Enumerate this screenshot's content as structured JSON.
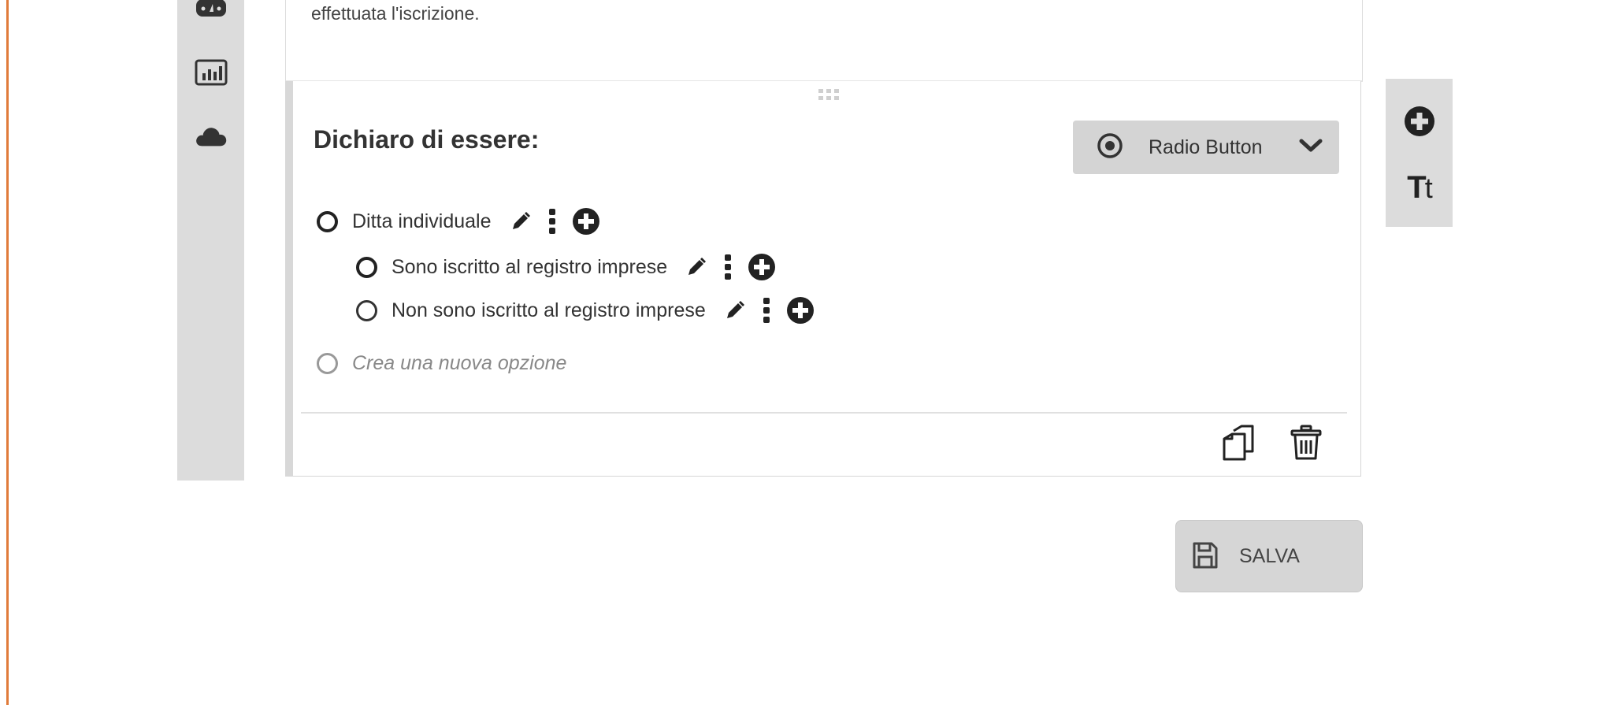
{
  "card_top": {
    "text": "effettuata l'iscrizione."
  },
  "question": {
    "title": "Dichiaro di essere:",
    "type_selector": {
      "label": "Radio Button",
      "icon": "radio-target-icon"
    },
    "options": [
      {
        "label": "Ditta individuale",
        "level": 0
      },
      {
        "label": "Sono iscritto al registro imprese",
        "level": 1
      },
      {
        "label": "Non sono iscritto al registro imprese",
        "level": 1
      }
    ],
    "new_option_placeholder": "Crea una nuova opzione"
  },
  "save_button": {
    "label": "SALVA"
  },
  "left_toolbar": {
    "icons": [
      "gauge-icon",
      "bar-chart-icon",
      "cloud-icon"
    ]
  },
  "right_toolbar": {
    "text_tool_glyph_big": "T",
    "text_tool_glyph_small": "t"
  },
  "colors": {
    "accent": "#e07b3a",
    "toolbar_bg": "#dcdcdc",
    "selector_bg": "#d4d4d4"
  }
}
